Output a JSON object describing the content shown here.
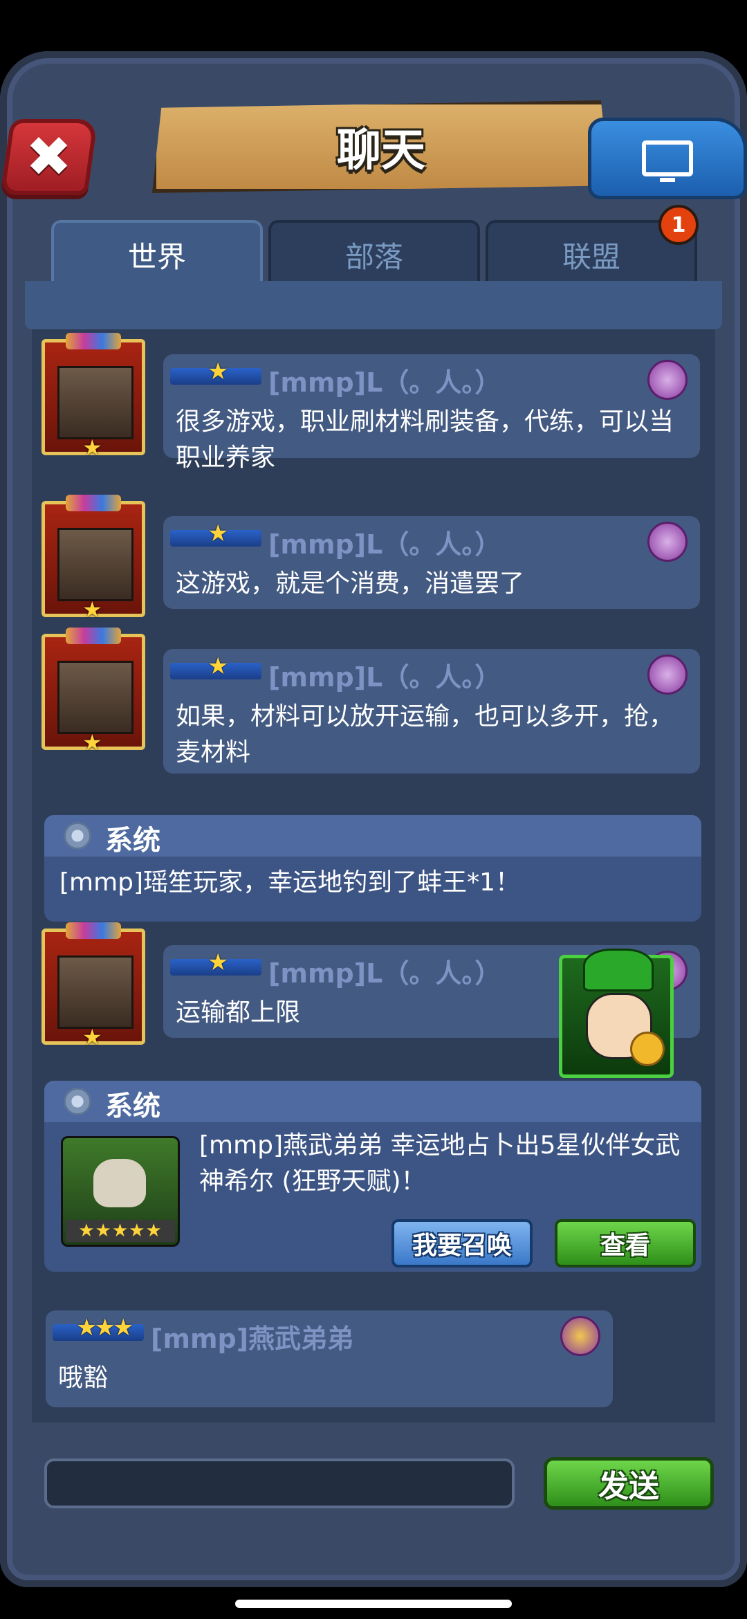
{
  "header": {
    "title": "聊天"
  },
  "tabs": [
    {
      "label": "世界",
      "active": true
    },
    {
      "label": "部落",
      "active": false
    },
    {
      "label": "联盟",
      "active": false,
      "badge": "1"
    }
  ],
  "messages": [
    {
      "username": "[mmp]L（。人。）",
      "rank_stars": 1,
      "text": "很多游戏，职业刷材料刷装备，代练，可以当职业养家"
    },
    {
      "username": "[mmp]L（。人。）",
      "rank_stars": 1,
      "text": "这游戏，就是个消费，消遣罢了"
    },
    {
      "username": "[mmp]L（。人。）",
      "rank_stars": 1,
      "text": "如果，材料可以放开运输，也可以多开，抢，麦材料"
    },
    {
      "system_title": "系统",
      "text": "[mmp]瑶笙玩家，幸运地钓到了蚌王*1！"
    },
    {
      "username": "[mmp]L（。人。）",
      "rank_stars": 1,
      "text": "运输都上限"
    },
    {
      "system_title": "系统",
      "text": "[mmp]燕武弟弟 幸运地占卜出5星伙伴女武神希尔 (狂野天赋)！",
      "summon_label": "我要召唤",
      "view_label": "查看",
      "card_stars": "★★★★★"
    },
    {
      "username": "[mmp]燕武弟弟",
      "rank_stars": 3,
      "text": "哦豁"
    }
  ],
  "rank_star_glyph": "★",
  "input": {
    "placeholder": ""
  },
  "send_label": "发送",
  "colors": {
    "frame": "#3a4a66",
    "bubble": "#435a82",
    "system": "#3d5584",
    "send_green": "#2e8f1a",
    "close_red": "#c02a30"
  }
}
